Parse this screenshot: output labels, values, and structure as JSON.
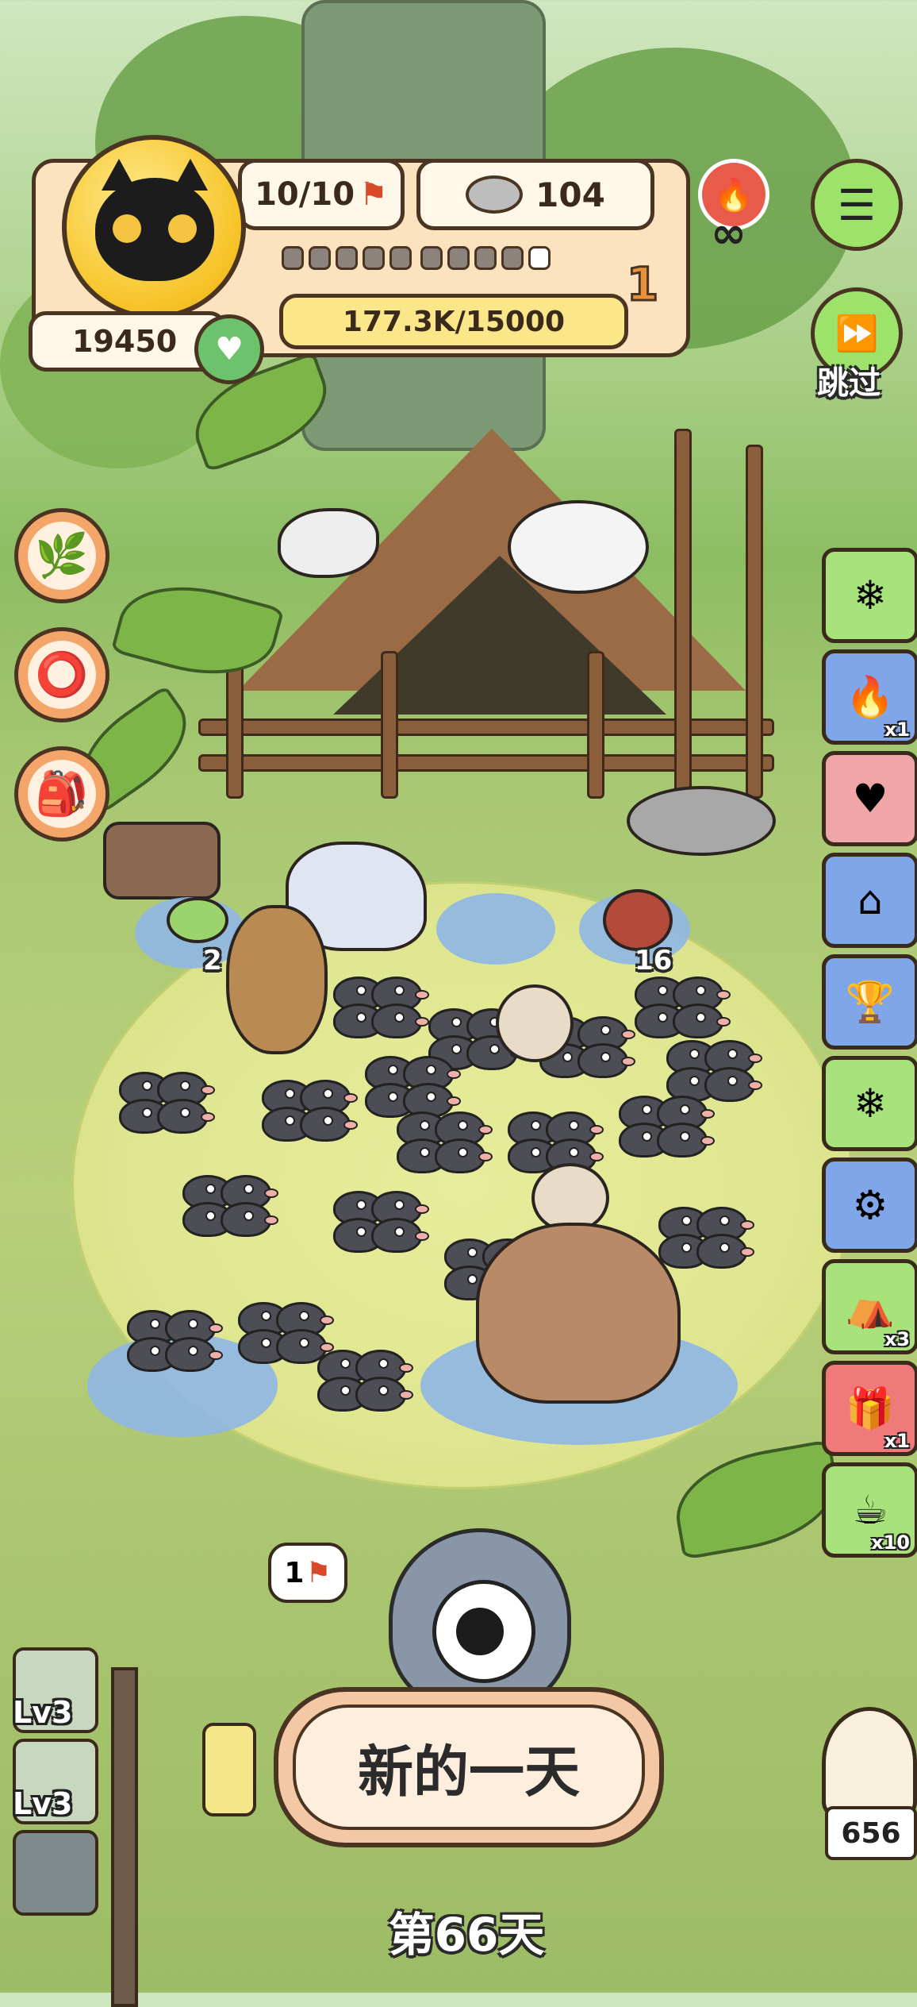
{
  "hud": {
    "energy": "10/10",
    "coins": "104",
    "points": "19450",
    "progress_text": "177.3K/15000",
    "level_badge": "1",
    "progress_fraction": 0.9,
    "infinite_symbol": "∞"
  },
  "skip": {
    "label": "跳过"
  },
  "field": {
    "frog_count": "2",
    "meat_count": "16"
  },
  "side_items": [
    {
      "icon": "snow-globe-icon",
      "glyph": "❄",
      "count": ""
    },
    {
      "icon": "fireplace-icon",
      "glyph": "🔥",
      "count": "x1"
    },
    {
      "icon": "heart-pig-icon",
      "glyph": "♥",
      "count": ""
    },
    {
      "icon": "hut-icon",
      "glyph": "⌂",
      "count": ""
    },
    {
      "icon": "trophy-icon",
      "glyph": "🏆",
      "count": ""
    },
    {
      "icon": "snow-globe-icon",
      "glyph": "❄",
      "count": ""
    },
    {
      "icon": "gear-mouse-icon",
      "glyph": "⚙",
      "count": ""
    },
    {
      "icon": "tent-icon",
      "glyph": "⛺",
      "count": "x3"
    },
    {
      "icon": "gift-bag-icon",
      "glyph": "🎁",
      "count": "x1"
    },
    {
      "icon": "soup-bowl-icon",
      "glyph": "☕",
      "count": "x10"
    }
  ],
  "character": {
    "bubble": "1"
  },
  "levels": [
    {
      "label": "Lv3"
    },
    {
      "label": "Lv3"
    }
  ],
  "main_button": {
    "label": "新的一天"
  },
  "day": {
    "label": "第66天"
  },
  "chick": {
    "count": "656"
  },
  "colors": {
    "accent": "#f6c326",
    "panel": "#fbe3bf",
    "outline": "#4a3422"
  }
}
